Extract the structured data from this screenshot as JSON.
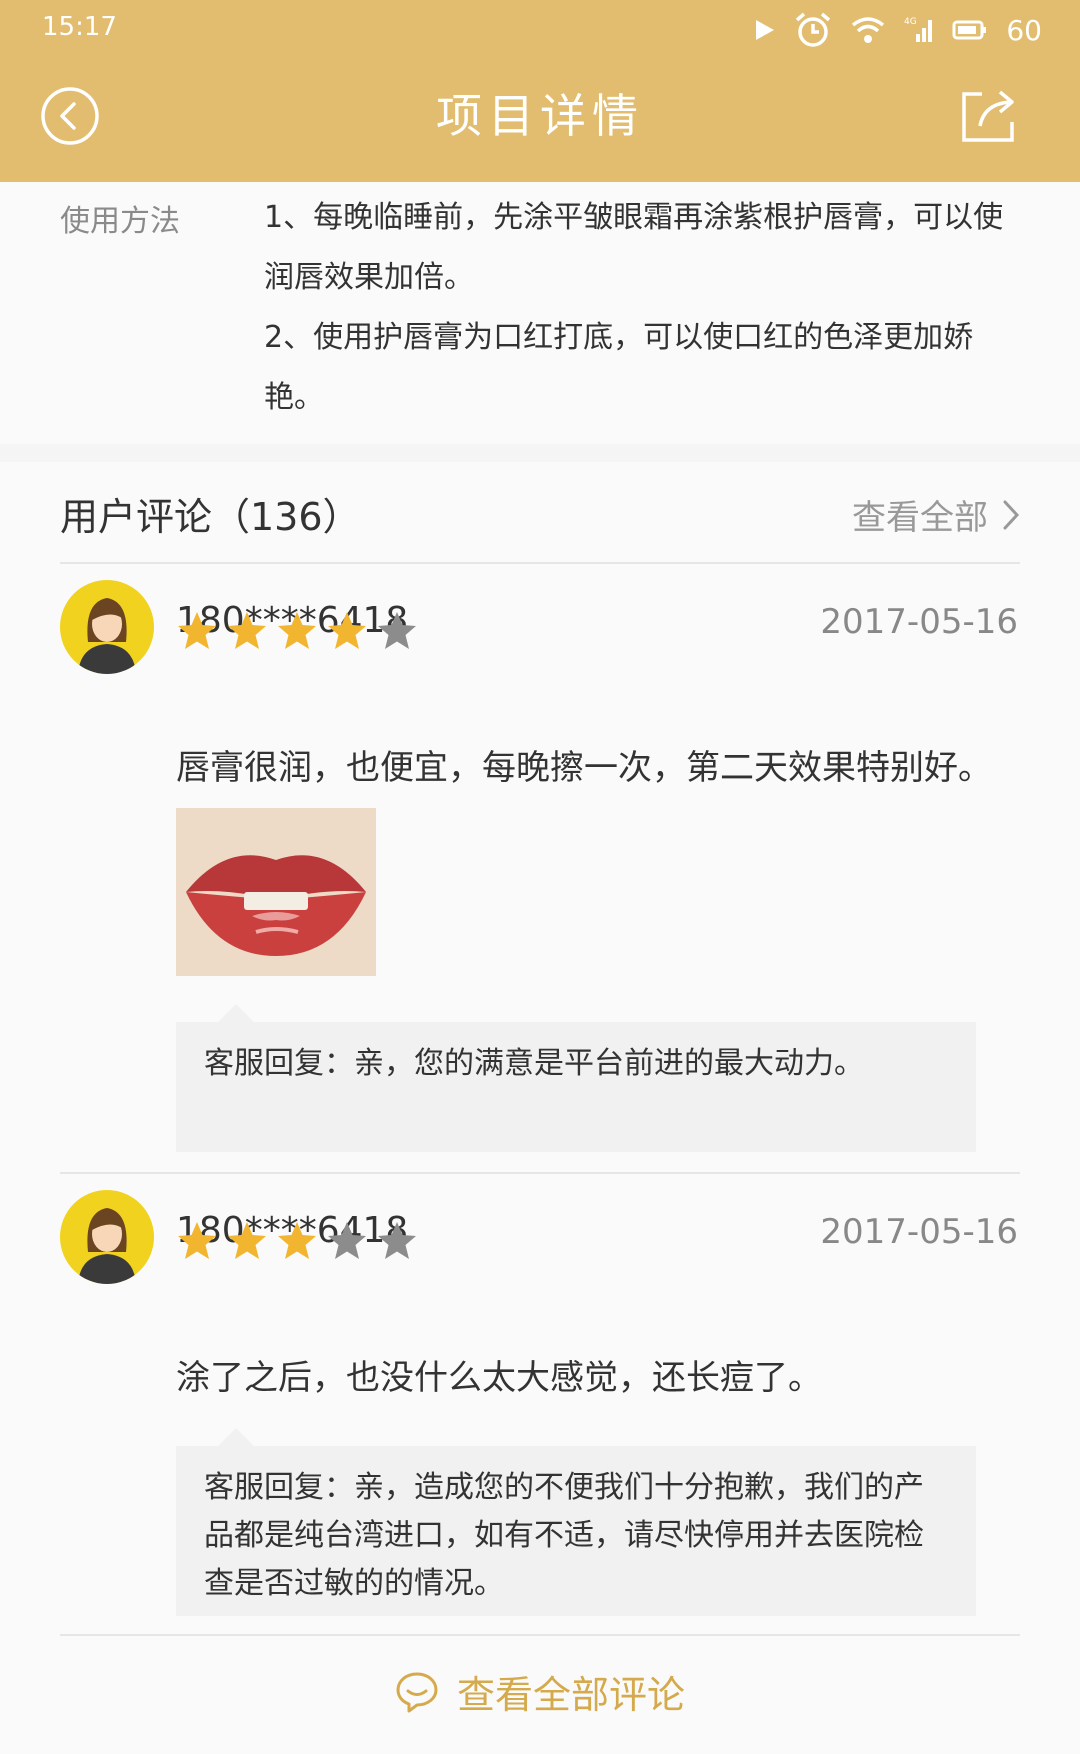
{
  "status_bar": {
    "time": "15:17",
    "battery": "60",
    "network": "4G"
  },
  "header": {
    "title": "项目详情",
    "back_icon": "back-circle-icon",
    "share_icon": "share-icon",
    "background": "#e2bd6f"
  },
  "usage": {
    "label": "使用方法",
    "lines": [
      "1、每晚临睡前，先涂平皱眼霜再涂紫根护唇膏，可以使润唇效果加倍。",
      "2、使用护唇膏为口红打底，可以使口红的色泽更加娇艳。"
    ]
  },
  "comments": {
    "title": "用户评论（136）",
    "view_all": "查看全部",
    "items": [
      {
        "user": "180****6418",
        "date": "2017-05-16",
        "rating": 4,
        "text": "唇膏很润，也便宜，每晚擦一次，第二天效果特别好。",
        "reply": "客服回复：亲，您的满意是平台前进的最大动力。"
      },
      {
        "user": "180****6418",
        "date": "2017-05-16",
        "rating": 3,
        "text": "涂了之后，也没什么太大感觉，还长痘了。",
        "reply": "客服回复：亲，造成您的不便我们十分抱歉，我们的产品都是纯台湾进口，如有不适，请尽快停用并去医院检查是否过敏的的情况。"
      }
    ],
    "footer_link": "查看全部评论"
  },
  "colors": {
    "accent": "#e2bd6f",
    "link": "#d4aa4c",
    "star": "#f2b52f"
  }
}
